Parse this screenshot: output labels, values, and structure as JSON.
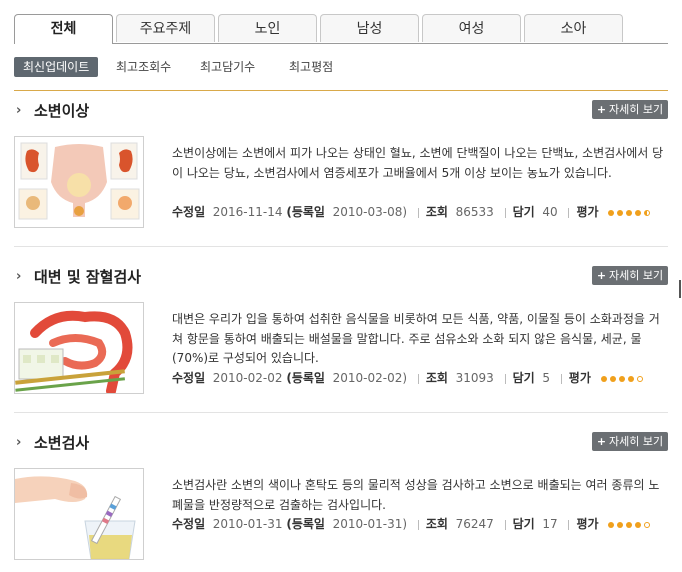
{
  "tabs": [
    "전체",
    "주요주제",
    "노인",
    "남성",
    "여성",
    "소아"
  ],
  "active_tab": 0,
  "sort": {
    "options": [
      "최신업데이트",
      "최고조회수",
      "최고담기수",
      "최고평점"
    ],
    "active": 0
  },
  "more_label": "자세히 보기",
  "meta_labels": {
    "modified": "수정일",
    "registered": "(등록일",
    "views": "조회",
    "saves": "담기",
    "rating": "평가"
  },
  "articles": [
    {
      "title": "소변이상",
      "description": "소변이상에는 소변에서 피가 나오는 상태인 혈뇨, 소변에 단백질이 나오는 단백뇨, 소변검사에서 당이 나오는 당뇨, 소변검사에서 염증세포가 고배율에서 5개 이상 보이는 농뇨가 있습니다.",
      "modified": "2016-11-14",
      "registered": "2010-03-08)",
      "views": "86533",
      "saves": "40",
      "rating": 4.5,
      "thumb_icon": "kidney-bladder-illustration"
    },
    {
      "title": "대변 및 잠혈검사",
      "description": "대변은 우리가 입을 통하여 섭취한 음식물을 비롯하여 모든 식품, 약품, 이물질 등이 소화과정을 거쳐 항문을 통하여 배출되는 배설물을 말합니다. 주로 섬유소와 소화 되지 않은 음식물, 세균, 물(70%)로 구성되어 있습니다.",
      "modified": "2010-02-02",
      "registered": "2010-02-02)",
      "views": "31093",
      "saves": "5",
      "rating": 4,
      "thumb_icon": "intestine-test-illustration"
    },
    {
      "title": "소변검사",
      "description": "소변검사란 소변의 색이나 혼탁도 등의 물리적 성상을 검사하고 소변으로 배출되는 여러 종류의 노폐물을 반정량적으로 검출하는 검사입니다.",
      "modified": "2010-01-31",
      "registered": "2010-01-31)",
      "views": "76247",
      "saves": "17",
      "rating": 4,
      "thumb_icon": "urine-cup-strip-illustration"
    }
  ],
  "colors": {
    "accent_line": "#d9a94a",
    "star": "#f0a01c",
    "button_bg": "#6b6f73",
    "active_sort_bg": "#5f6870"
  }
}
